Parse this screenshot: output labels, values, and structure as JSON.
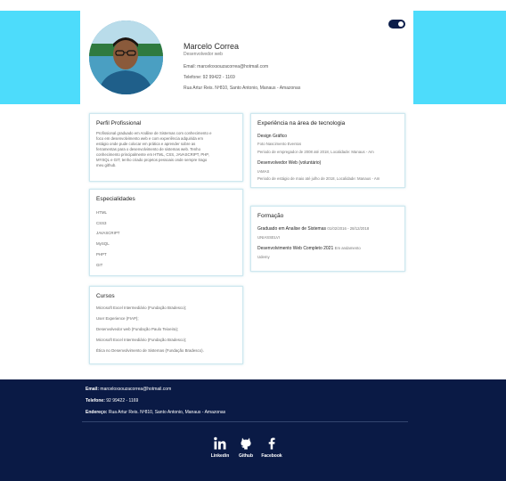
{
  "profile": {
    "name": "Marcelo Correa",
    "role": "Desenvolvedor web",
    "email": "Email: marceloxsouzacorrea@hotmail.com",
    "phone": "Telefone: 92 99422 - 1169",
    "address": "Rua Artur Reis. Nº810, Santo Antonio, Manaus - Amazonas"
  },
  "perfil": {
    "title": "Perfil Profissional",
    "text": "Profissional graduado em Análise de Sistemas com conhecimento e foco em desenvolvimento web e com experiência adquirida em estágio onde pude colocar em prática e aprender sobre as ferramentas para o desenvolvimento de sistemas web. Tenho conhecimento principalmente em HTML, CSS, JAVASCRIPT, PHP, MYSQL e GIT, tenho criado projetos pessoais onde sempre trago meu github."
  },
  "especialidades": {
    "title": "Especialidades",
    "items": [
      "HTML",
      "CSS3",
      "JAVASCRIPT",
      "MySQL",
      "PHPT",
      "GIT"
    ]
  },
  "cursos": {
    "title": "Cursos",
    "items": [
      "Microsoft Excel Intermediário (Fundação Bradesco);",
      "User Experience (FIAP);",
      "Desenvolvedor web (Fundação Paulo Teixeira);",
      "Microsoft Excel Intermediário (Fundação Bradesco);",
      "Ética no Desenvolvimento de Sistemas (Fundação Bradesco)."
    ]
  },
  "experiencia": {
    "title": "Experiência na área de tecnologia",
    "jobs": [
      {
        "title": "Design Gráfico",
        "company": "Foto Nascimento Eventos",
        "desc": "Periodo de empregador de 2008 até 2018, Localidade: Manaus - Am"
      },
      {
        "title": "Desenvolvedor Web (voluntário)",
        "company": "IAMAS",
        "desc": "Periodo de estágio de maio até julho de 2018, Localidade: Manaus - Am"
      }
    ]
  },
  "formacao": {
    "title": "Formação",
    "items": [
      {
        "title": "Graduado em Analise de Sistemas",
        "date": "01/02/2016 - 28/12/2018",
        "school": "UNIASSELVI"
      },
      {
        "title": "Desenvolvimento Web Completo 2021",
        "date": "Em andamento",
        "school": "Udemy"
      }
    ]
  },
  "footer": {
    "email_label": "Email:",
    "email": "marceloxsouzacorrea@hotmail.com",
    "phone_label": "Telefone:",
    "phone": "92 99422 - 1169",
    "address_label": "Endereço:",
    "address": "Rua Artur Reis. Nº810, Santo Antonio, Manaus - Amazonas",
    "social": [
      {
        "label": "Linkedin",
        "icon": "linkedin-icon"
      },
      {
        "label": "Github",
        "icon": "github-icon"
      },
      {
        "label": "Facebook",
        "icon": "facebook-icon"
      }
    ]
  },
  "colors": {
    "accent": "#4ddcfb",
    "footer_bg": "#0a1a45",
    "card_border": "#cfe8ef"
  }
}
